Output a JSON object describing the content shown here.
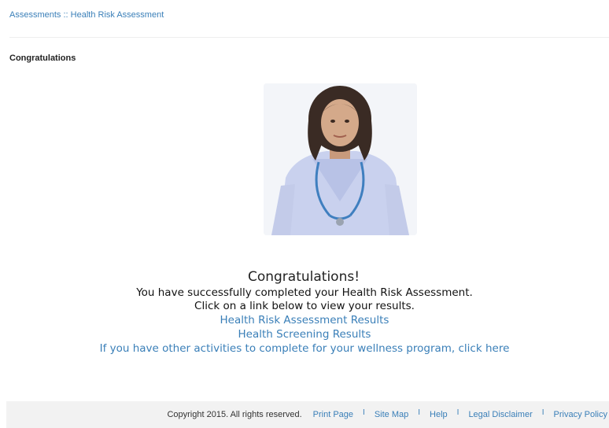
{
  "breadcrumb": {
    "parent": "Assessments",
    "separator": " :: ",
    "current": "Health Risk Assessment"
  },
  "section_title": "Congratulations",
  "photo": {
    "alt": "Doctor in scrubs with stethoscope"
  },
  "message": {
    "heading": "Congratulations!",
    "line1": "You have successfully completed your Health Risk Assessment.",
    "line2": "Click on a link below to view your results.",
    "link_hra": "Health Risk Assessment Results",
    "link_screening": "Health Screening Results",
    "link_other": "If you have other activities to complete for your wellness program, click here"
  },
  "footer": {
    "copyright": "Copyright 2015. All rights reserved.",
    "links": [
      "Print Page",
      "Site Map",
      "Help",
      "Legal Disclaimer",
      "Privacy Policy"
    ],
    "separator": "I"
  },
  "colors": {
    "link": "#3a7fb8",
    "footer_bg": "#f2f2f2"
  }
}
